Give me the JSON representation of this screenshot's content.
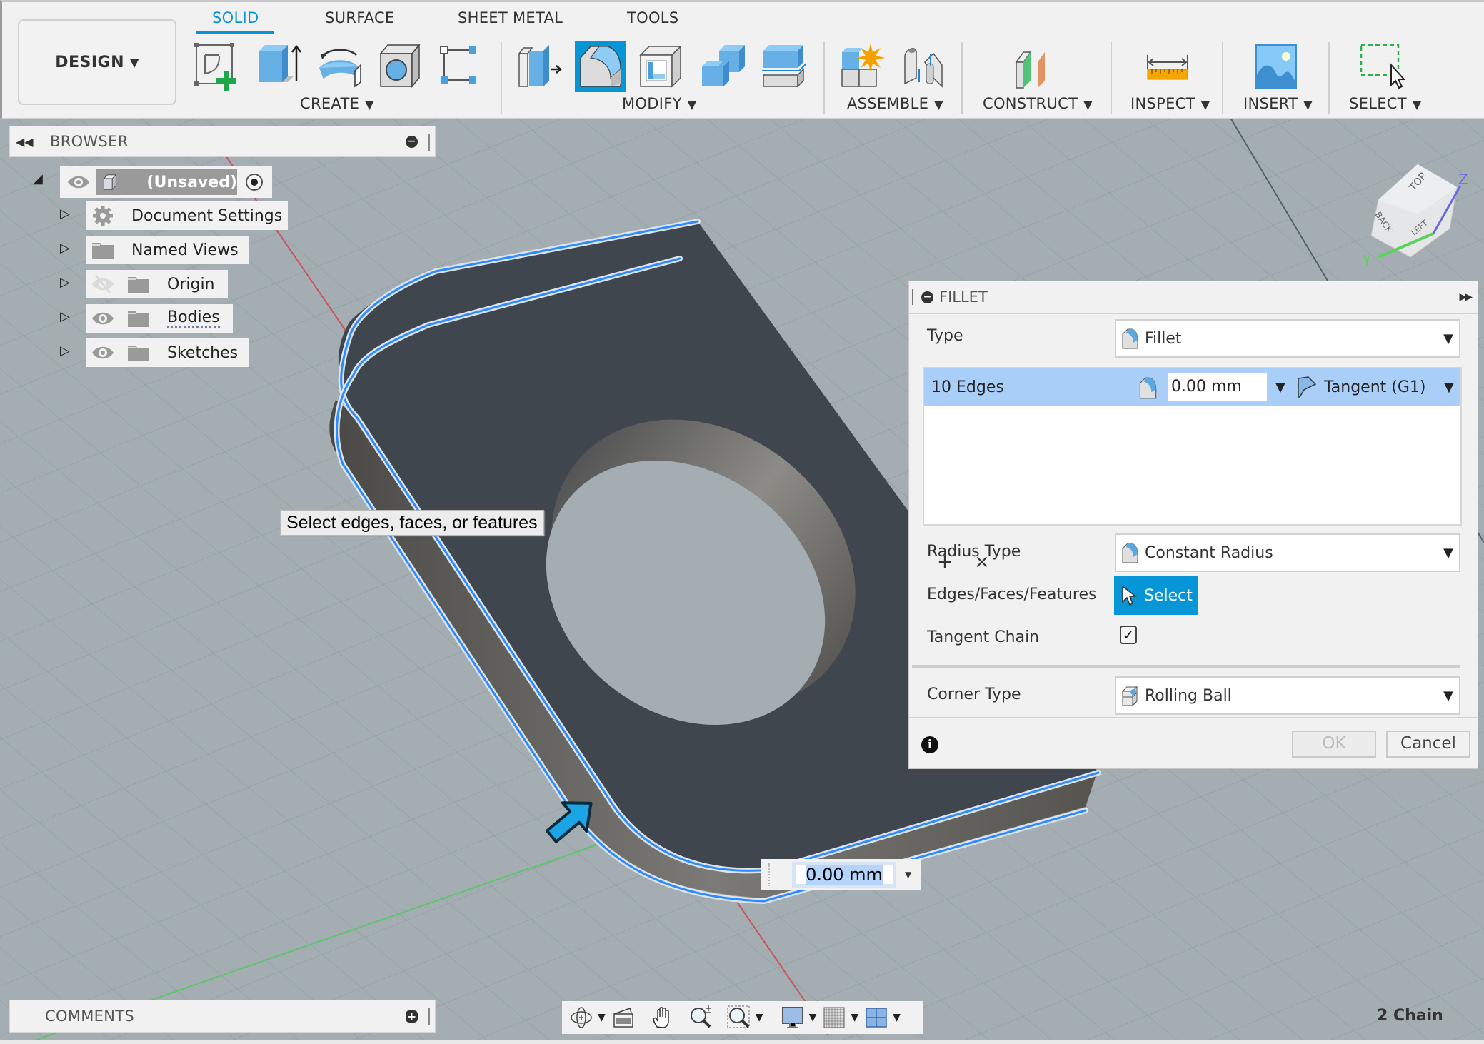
{
  "ribbon": {
    "workspace_button": "DESIGN",
    "tabs": [
      {
        "label": "SOLID",
        "active": true
      },
      {
        "label": "SURFACE",
        "active": false
      },
      {
        "label": "SHEET METAL",
        "active": false
      },
      {
        "label": "TOOLS",
        "active": false
      }
    ],
    "groups": [
      {
        "label": "CREATE",
        "tools": [
          "create-sketch",
          "extrude",
          "revolve",
          "hole",
          "pattern"
        ]
      },
      {
        "label": "MODIFY",
        "tools": [
          "press-pull",
          "fillet",
          "shell",
          "combine",
          "split-body"
        ],
        "active_tool": "fillet"
      },
      {
        "label": "ASSEMBLE",
        "tools": [
          "new-component",
          "joint"
        ]
      },
      {
        "label": "CONSTRUCT",
        "tools": [
          "offset-plane"
        ]
      },
      {
        "label": "INSPECT",
        "tools": [
          "measure"
        ]
      },
      {
        "label": "INSERT",
        "tools": [
          "insert-image"
        ]
      },
      {
        "label": "SELECT",
        "tools": [
          "window-select"
        ]
      }
    ]
  },
  "browser": {
    "title": "BROWSER",
    "root": {
      "label": "(Unsaved)",
      "visible": true
    },
    "items": [
      {
        "label": "Document Settings",
        "icon": "gear-icon",
        "visibility": "none"
      },
      {
        "label": "Named Views",
        "icon": "folder-icon",
        "visibility": "none"
      },
      {
        "label": "Origin",
        "icon": "folder-icon",
        "visibility": "hidden"
      },
      {
        "label": "Bodies",
        "icon": "folder-icon",
        "visibility": "visible"
      },
      {
        "label": "Sketches",
        "icon": "folder-icon",
        "visibility": "visible"
      }
    ]
  },
  "tooltip": "Select edges, faces, or features",
  "fillet_dialog": {
    "title": "FILLET",
    "type_label": "Type",
    "type_value": "Fillet",
    "edge_set": {
      "count_label": "10 Edges",
      "radius": "0.00 mm",
      "continuity": "Tangent (G1)"
    },
    "add_label": "+",
    "remove_label": "×",
    "radius_type_label": "Radius Type",
    "radius_type_value": "Constant Radius",
    "selection_label": "Edges/Faces/Features",
    "select_button": "Select",
    "tangent_chain_label": "Tangent Chain",
    "tangent_chain_checked": true,
    "corner_type_label": "Corner Type",
    "corner_type_value": "Rolling Ball",
    "ok": "OK",
    "cancel": "Cancel",
    "ok_enabled": false
  },
  "canvas": {
    "distance_input": "0.00 mm",
    "viewcube_faces": [
      "TOP",
      "BACK",
      "LEFT"
    ],
    "axes": [
      "Y",
      "Z"
    ]
  },
  "comments": {
    "title": "COMMENTS"
  },
  "status": "2 Chain",
  "colors": {
    "accent": "#0696d7",
    "selection_highlight": "#a9cff9",
    "edge_highlight": "#2e8bff",
    "body_face": "#3f464d",
    "body_side": "#5e5d5a",
    "canvas_bg": "#a3adb2"
  }
}
